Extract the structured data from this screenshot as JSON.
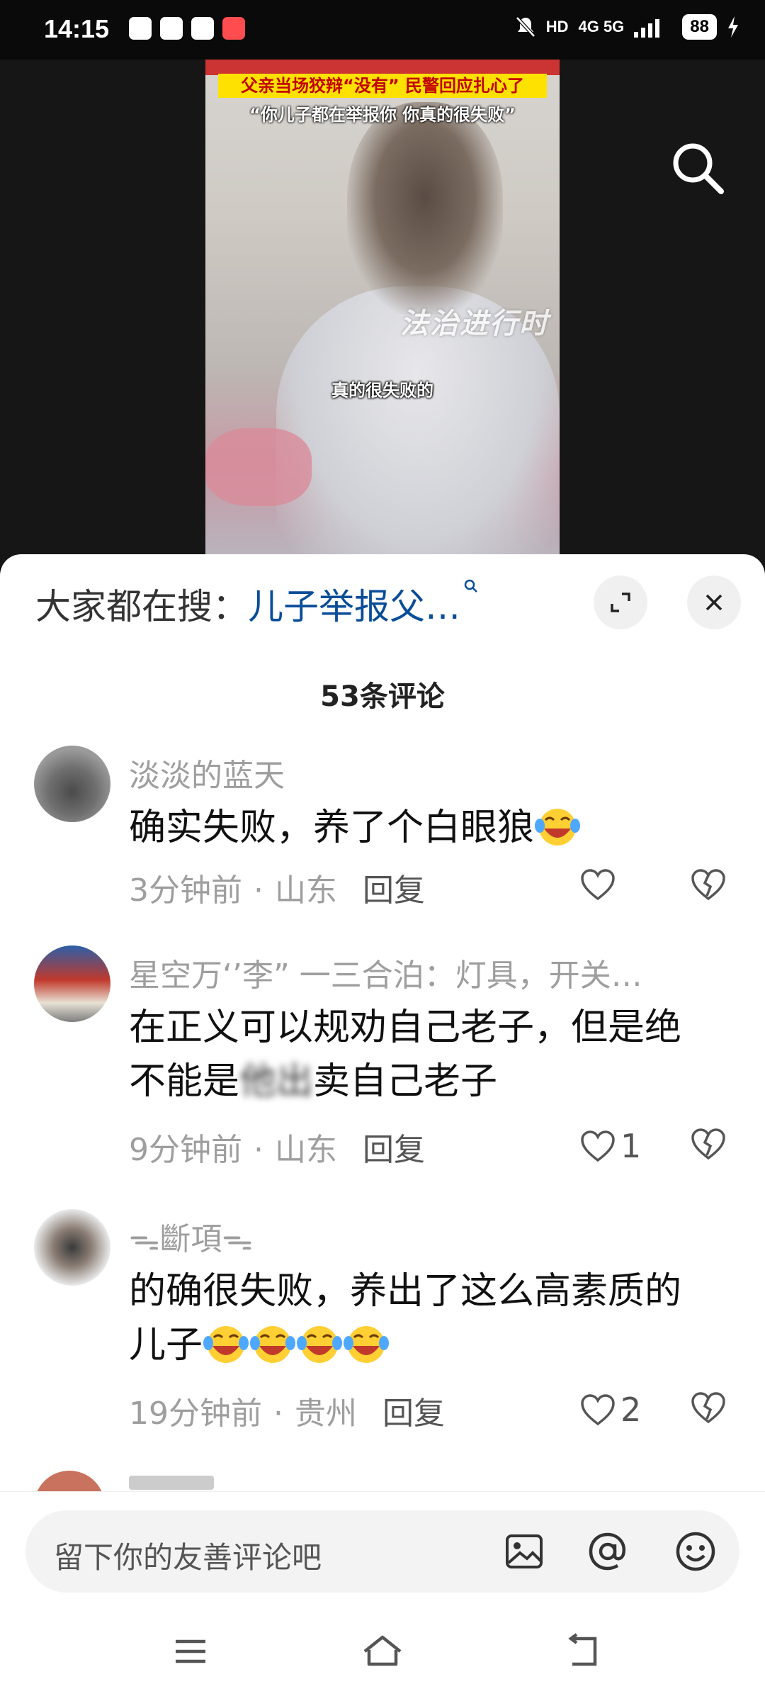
{
  "status_bar": {
    "time": "14:15",
    "network": "4G 5G",
    "battery": "88"
  },
  "video": {
    "cover_line1": "父亲当场狡辩“没有” 民警回应扎心了",
    "cover_line2": "“你儿子都在举报你 你真的很失败”",
    "watermark": "法治进行时",
    "subtitle": "真的很失败的"
  },
  "sheet": {
    "hot_search_prefix": "大家都在搜：",
    "hot_search_query": "儿子举报父…",
    "comment_count": "53条评论"
  },
  "comments": [
    {
      "username": "淡淡的蓝天",
      "text": "确实失败，养了个白眼狼",
      "time": "3分钟前",
      "location": "山东",
      "reply": "回复",
      "likes": ""
    },
    {
      "username": "星空万‘’李” 一三合泊：灯具，开关…",
      "text_before": "在正义可以规劝自己老子，但是绝不能是",
      "text_blurred": "他出",
      "text_after": "卖自己老子",
      "time": "9分钟前",
      "location": "山东",
      "reply": "回复",
      "likes": "1"
    },
    {
      "username": "ᯓ斷項ᯓ",
      "text": "的确很失败，养出了这么高素质的儿子",
      "time": "19分钟前",
      "location": "贵州",
      "reply": "回复",
      "likes": "2"
    }
  ],
  "input": {
    "placeholder": "留下你的友善评论吧"
  },
  "icons": {
    "search": "search-icon",
    "expand": "expand-icon",
    "close": "close-icon",
    "like": "heart-icon",
    "dislike": "broken-heart-icon",
    "image": "image-icon",
    "mention": "at-icon",
    "emoji": "emoji-icon"
  },
  "colors": {
    "query_link": "#0a4d98",
    "meta_gray": "#9e9e9e",
    "cover_banner": "#ffe100"
  }
}
